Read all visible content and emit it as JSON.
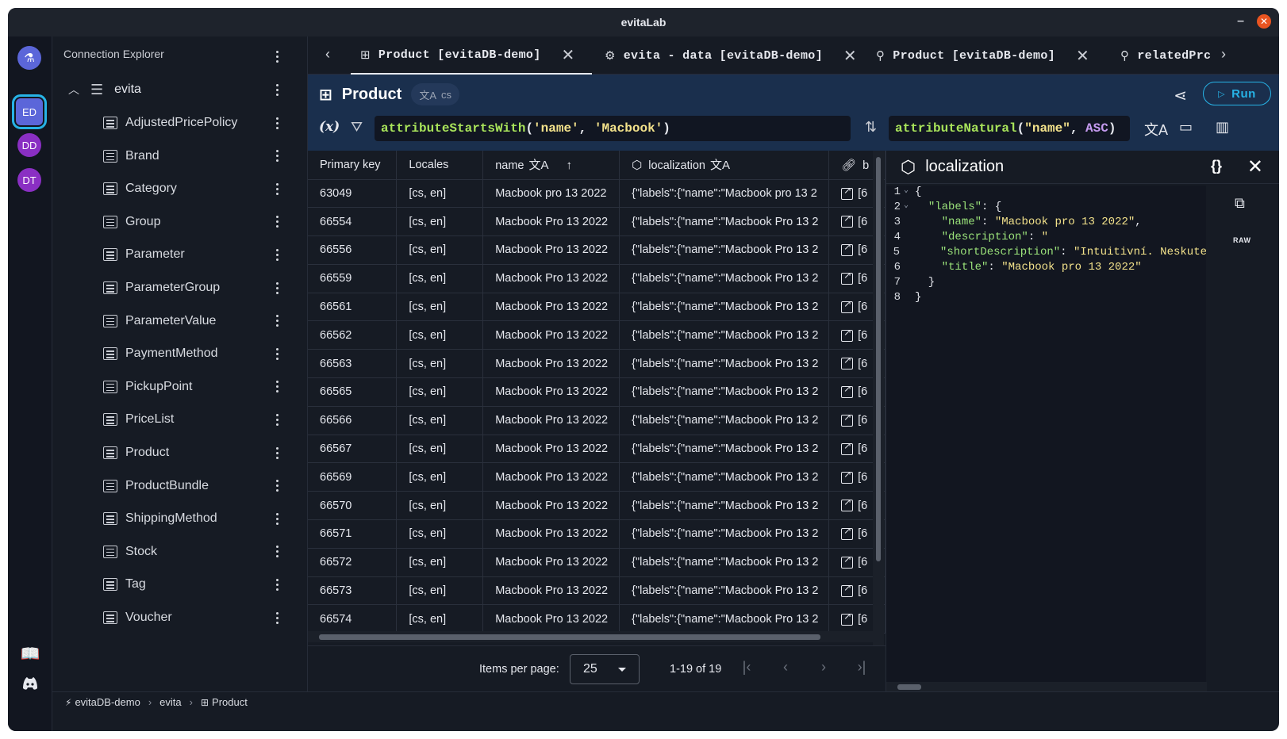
{
  "window": {
    "title": "evitaLab",
    "minimize": "–",
    "close": "✕"
  },
  "rail": {
    "logo_icon": "flask-icon",
    "connections": [
      {
        "initials": "ED"
      },
      {
        "initials": "DD"
      },
      {
        "initials": "DT"
      }
    ]
  },
  "explorer": {
    "title": "Connection Explorer",
    "root": {
      "label": "evita"
    },
    "items": [
      "AdjustedPricePolicy",
      "Brand",
      "Category",
      "Group",
      "Parameter",
      "ParameterGroup",
      "ParameterValue",
      "PaymentMethod",
      "PickupPoint",
      "PriceList",
      "Product",
      "ProductBundle",
      "ShippingMethod",
      "Stock",
      "Tag",
      "Voucher"
    ]
  },
  "tabs": [
    {
      "label": "Product [evitaDB-demo]",
      "icon": "grid-icon"
    },
    {
      "label": "evita - data [evitaDB-demo]",
      "icon": "gear-icon"
    },
    {
      "label": "Product [evitaDB-demo]",
      "icon": "graph-icon"
    },
    {
      "label": "relatedPrc",
      "icon": "graph-icon"
    }
  ],
  "query": {
    "title": "Product",
    "locale": "cs",
    "run_label": "Run",
    "var_label": "(x)",
    "filter": {
      "fn": "attributeStartsWith",
      "open": "(",
      "arg1": "'name'",
      "sep": ", ",
      "arg2": "'Macbook'",
      "close": ")"
    },
    "order": {
      "fn": "attributeNatural",
      "open": "(",
      "arg1": "\"name\"",
      "sep": ", ",
      "arg2": "ASC",
      "close": ")"
    }
  },
  "table": {
    "columns": [
      "Primary key",
      "Locales",
      "name",
      "localization",
      "b"
    ],
    "rows": [
      [
        "63049",
        "[cs, en]",
        "Macbook pro 13 2022",
        "{\"labels\":{\"name\":\"Macbook pro 13 2",
        "[6"
      ],
      [
        "66554",
        "[cs, en]",
        "Macbook Pro 13 2022",
        "{\"labels\":{\"name\":\"Macbook Pro 13 2",
        "[6"
      ],
      [
        "66556",
        "[cs, en]",
        "Macbook Pro 13 2022",
        "{\"labels\":{\"name\":\"Macbook Pro 13 2",
        "[6"
      ],
      [
        "66559",
        "[cs, en]",
        "Macbook Pro 13 2022",
        "{\"labels\":{\"name\":\"Macbook Pro 13 2",
        "[6"
      ],
      [
        "66561",
        "[cs, en]",
        "Macbook Pro 13 2022",
        "{\"labels\":{\"name\":\"Macbook Pro 13 2",
        "[6"
      ],
      [
        "66562",
        "[cs, en]",
        "Macbook Pro 13 2022",
        "{\"labels\":{\"name\":\"Macbook Pro 13 2",
        "[6"
      ],
      [
        "66563",
        "[cs, en]",
        "Macbook Pro 13 2022",
        "{\"labels\":{\"name\":\"Macbook Pro 13 2",
        "[6"
      ],
      [
        "66565",
        "[cs, en]",
        "Macbook Pro 13 2022",
        "{\"labels\":{\"name\":\"Macbook Pro 13 2",
        "[6"
      ],
      [
        "66566",
        "[cs, en]",
        "Macbook Pro 13 2022",
        "{\"labels\":{\"name\":\"Macbook Pro 13 2",
        "[6"
      ],
      [
        "66567",
        "[cs, en]",
        "Macbook Pro 13 2022",
        "{\"labels\":{\"name\":\"Macbook Pro 13 2",
        "[6"
      ],
      [
        "66569",
        "[cs, en]",
        "Macbook Pro 13 2022",
        "{\"labels\":{\"name\":\"Macbook Pro 13 2",
        "[6"
      ],
      [
        "66570",
        "[cs, en]",
        "Macbook Pro 13 2022",
        "{\"labels\":{\"name\":\"Macbook Pro 13 2",
        "[6"
      ],
      [
        "66571",
        "[cs, en]",
        "Macbook Pro 13 2022",
        "{\"labels\":{\"name\":\"Macbook Pro 13 2",
        "[6"
      ],
      [
        "66572",
        "[cs, en]",
        "Macbook Pro 13 2022",
        "{\"labels\":{\"name\":\"Macbook Pro 13 2",
        "[6"
      ],
      [
        "66573",
        "[cs, en]",
        "Macbook Pro 13 2022",
        "{\"labels\":{\"name\":\"Macbook Pro 13 2",
        "[6"
      ],
      [
        "66574",
        "[cs, en]",
        "Macbook Pro 13 2022",
        "{\"labels\":{\"name\":\"Macbook Pro 13 2",
        "[6"
      ]
    ]
  },
  "pager": {
    "label": "Items per page:",
    "per_page": "25",
    "range": "1-19 of 19"
  },
  "detail": {
    "title": "localization",
    "braces": "{}",
    "raw": "RAW",
    "code": [
      {
        "n": "1",
        "fold": "⌄",
        "parts": [
          [
            "p",
            "{"
          ]
        ]
      },
      {
        "n": "2",
        "fold": "⌄",
        "parts": [
          [
            "p",
            "  "
          ],
          [
            "k",
            "\"labels\""
          ],
          [
            "p",
            ": {"
          ]
        ]
      },
      {
        "n": "3",
        "fold": "",
        "parts": [
          [
            "p",
            "    "
          ],
          [
            "k",
            "\"name\""
          ],
          [
            "p",
            ": "
          ],
          [
            "s",
            "\"Macbook pro 13 2022\""
          ],
          [
            "p",
            ","
          ]
        ]
      },
      {
        "n": "4",
        "fold": "",
        "parts": [
          [
            "p",
            "    "
          ],
          [
            "k",
            "\"description\""
          ],
          [
            "p",
            ": "
          ],
          [
            "s",
            "\""
          ]
        ]
      },
      {
        "n": "5",
        "fold": "",
        "parts": [
          [
            "p",
            "    "
          ],
          [
            "k",
            "\"shortDescription\""
          ],
          [
            "p",
            ": "
          ],
          [
            "s",
            "\"Intuitivní. Neskute"
          ]
        ]
      },
      {
        "n": "6",
        "fold": "",
        "parts": [
          [
            "p",
            "    "
          ],
          [
            "k",
            "\"title\""
          ],
          [
            "p",
            ": "
          ],
          [
            "s",
            "\"Macbook pro 13 2022\""
          ]
        ]
      },
      {
        "n": "7",
        "fold": "",
        "parts": [
          [
            "p",
            "  }"
          ]
        ]
      },
      {
        "n": "8",
        "fold": "",
        "parts": [
          [
            "p",
            "}"
          ]
        ]
      }
    ]
  },
  "statusbar": {
    "connection": "evitaDB-demo",
    "catalog": "evita",
    "collection": "Product"
  }
}
